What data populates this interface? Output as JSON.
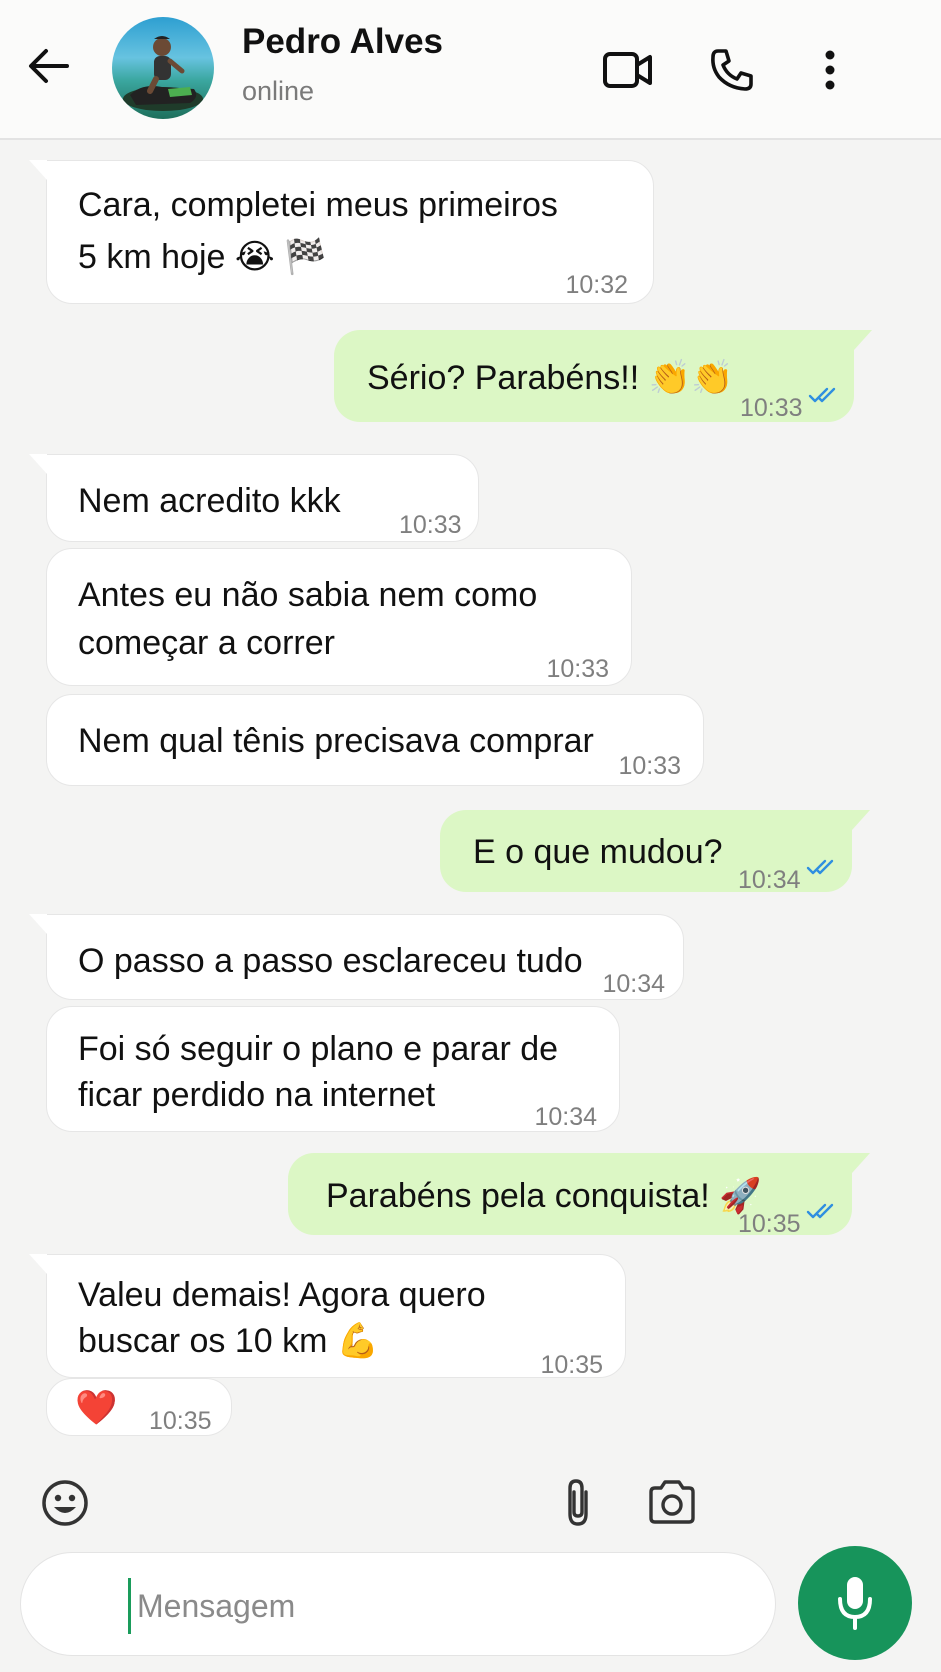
{
  "header": {
    "contact_name": "Pedro Alves",
    "status": "online",
    "icons": [
      "back-arrow-icon",
      "video-call-icon",
      "phone-icon",
      "more-options-icon"
    ]
  },
  "messages": [
    {
      "dir": "in",
      "lines": [
        "Cara, completei meus primeiros",
        "5 km hoje 😭 🏁"
      ],
      "time": "10:32"
    },
    {
      "dir": "out",
      "lines": [
        "Sério? Parabéns!! 👏👏"
      ],
      "time": "10:33",
      "status": "read"
    },
    {
      "dir": "in",
      "lines": [
        "Nem acredito kkk"
      ],
      "time": "10:33"
    },
    {
      "dir": "in",
      "lines": [
        "Antes eu não sabia nem como",
        "começar a correr"
      ],
      "time": "10:33"
    },
    {
      "dir": "in",
      "lines": [
        "Nem qual tênis precisava comprar"
      ],
      "time": "10:33"
    },
    {
      "dir": "out",
      "lines": [
        "E o que mudou?"
      ],
      "time": "10:34",
      "status": "read"
    },
    {
      "dir": "in",
      "lines": [
        "O passo a passo esclareceu tudo"
      ],
      "time": "10:34"
    },
    {
      "dir": "in",
      "lines": [
        "Foi só seguir o plano e parar de",
        "ficar perdido na internet"
      ],
      "time": "10:34"
    },
    {
      "dir": "out",
      "lines": [
        "Parabéns pela conquista! 🚀"
      ],
      "time": "10:35",
      "status": "read"
    },
    {
      "dir": "in",
      "lines": [
        "Valeu demais! Agora quero",
        "buscar os 10 km 💪"
      ],
      "time": "10:35"
    },
    {
      "dir": "in",
      "lines": [
        "❤️"
      ],
      "time": "10:35"
    }
  ],
  "composer": {
    "placeholder": "Mensagem",
    "icons": [
      "emoji-icon",
      "attach-icon",
      "camera-icon",
      "mic-icon"
    ]
  },
  "colors": {
    "outgoing_bubble": "#dcf7c5",
    "incoming_bubble": "#ffffff",
    "background": "#f4f4f3",
    "accent": "#17945b",
    "read_ticks": "#2f8fe0"
  }
}
